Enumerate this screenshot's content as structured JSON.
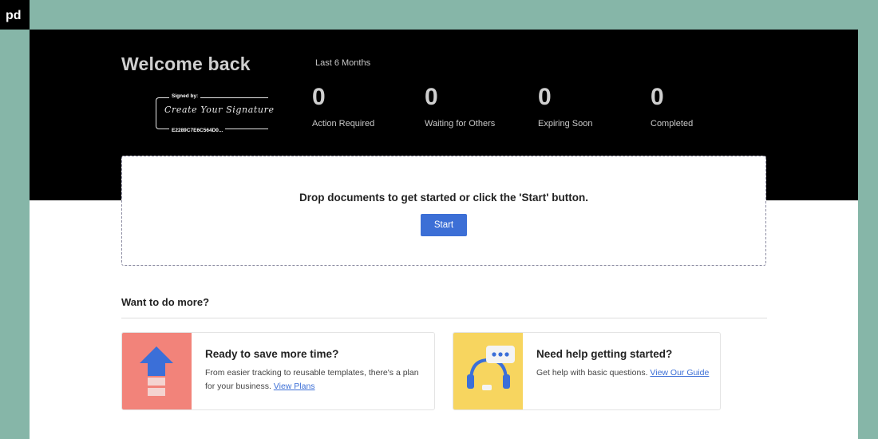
{
  "brand": {
    "logo_text": "pd"
  },
  "header": {
    "welcome": "Welcome back",
    "signature": {
      "label": "Signed by:",
      "script": "Create Your Signature",
      "id": "E2289C7E6C564D0..."
    },
    "period": "Last 6 Months",
    "stats": [
      {
        "value": "0",
        "label": "Action Required"
      },
      {
        "value": "0",
        "label": "Waiting for Others"
      },
      {
        "value": "0",
        "label": "Expiring Soon"
      },
      {
        "value": "0",
        "label": "Completed"
      }
    ]
  },
  "dropzone": {
    "text": "Drop documents to get started or click the 'Start' button.",
    "button": "Start"
  },
  "more": {
    "title": "Want to do more?",
    "cards": [
      {
        "title": "Ready to save more time?",
        "desc": "From easier tracking to reusable templates, there's a plan for your business.",
        "link": "View Plans",
        "icon": "upgrade-arrow-icon",
        "color": "#f2837a"
      },
      {
        "title": "Need help getting started?",
        "desc": "Get help with basic questions.",
        "link": "View Our Guide",
        "icon": "headset-support-icon",
        "color": "#f7d55f"
      }
    ]
  },
  "colors": {
    "accent": "#3c6fd6",
    "frame": "#86b6a8",
    "header_bg": "#000000"
  }
}
